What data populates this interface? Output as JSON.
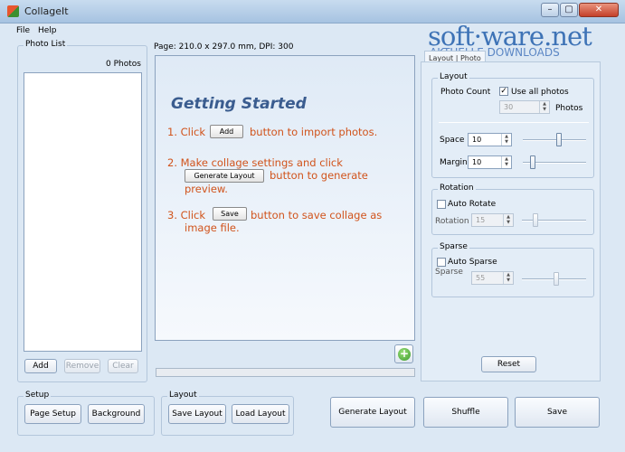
{
  "window": {
    "title": "CollageIt",
    "min_symbol": "–",
    "max_symbol": "▢",
    "close_symbol": "✕"
  },
  "menu": [
    {
      "label": "File"
    },
    {
      "label": "Help"
    }
  ],
  "watermark": {
    "line1": "soft·ware.net",
    "line2": "AKTUELLE DOWNLOADS"
  },
  "photo_list": {
    "legend": "Photo List",
    "count": "0 Photos",
    "add_label": "Add",
    "remove_label": "Remove",
    "clear_label": "Clear"
  },
  "page_info": "Page: 210.0 x 297.0 mm, DPI: 300",
  "getting_started": {
    "title": "Getting Started",
    "step1_prefix": "1. Click",
    "step1_button": "Add",
    "step1_suffix": "button to import photos.",
    "step2_line1": "2. Make collage settings and click",
    "step2_button": "Generate Layout",
    "step2_suffix": "button to generate",
    "step2_line3": "preview.",
    "step3_prefix": "3. Click",
    "step3_button": "Save",
    "step3_suffix": "button to save collage as",
    "step3_line2": "image file."
  },
  "tabs": {
    "tab1": "Layout",
    "tab2": "Photo"
  },
  "layout_group": {
    "legend": "Layout",
    "photo_count_label": "Photo Count",
    "use_all_label": "Use all photos",
    "use_all_checked": "✓",
    "photo_count_value": "30",
    "photos_unit": "Photos",
    "space_label": "Space",
    "space_value": "10",
    "margin_label": "Margin",
    "margin_value": "10"
  },
  "rotation_group": {
    "legend": "Rotation",
    "auto_label": "Auto Rotate",
    "rotation_label": "Rotation",
    "rotation_value": "15"
  },
  "sparse_group": {
    "legend": "Sparse",
    "auto_label": "Auto Sparse",
    "sparse_label": "Sparse",
    "sparse_value": "55"
  },
  "reset_label": "Reset",
  "setup_group": {
    "legend": "Setup",
    "page_setup": "Page Setup",
    "background": "Background"
  },
  "layout_bottom_group": {
    "legend": "Layout",
    "save_layout": "Save Layout",
    "load_layout": "Load Layout"
  },
  "actions": {
    "generate": "Generate Layout",
    "shuffle": "Shuffle",
    "save": "Save"
  },
  "icons": {
    "app": "collageit-app-icon",
    "add_photo": "plus-circle-icon"
  },
  "colors": {
    "step_text": "#d1531b",
    "title_text": "#3a5c8f",
    "watermark": "#3e73b6"
  }
}
